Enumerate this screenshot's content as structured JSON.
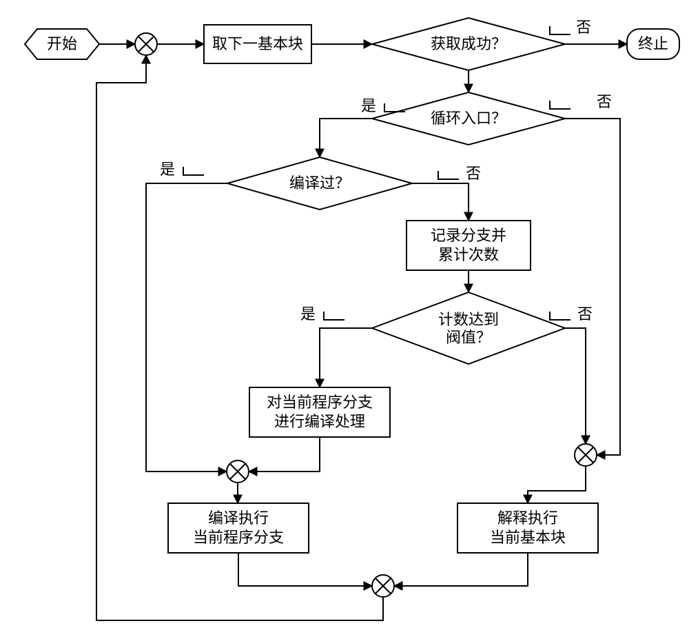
{
  "nodes": {
    "start": "开始",
    "end": "终止",
    "fetch": "取下一基本块",
    "q_success_l1": "获取成功？",
    "q_loopentry_l1": "循环入口？",
    "q_compiled_l1": "编译过？",
    "record_l1": "记录分支并",
    "record_l2": "累计次数",
    "q_threshold_l1": "计数达到",
    "q_threshold_l2": "阀值？",
    "compile_l1": "对当前程序分支",
    "compile_l2": "进行编译处理",
    "exec_compile_l1": "编译执行",
    "exec_compile_l2": "当前程序分支",
    "exec_interp_l1": "解释执行",
    "exec_interp_l2": "当前基本块"
  },
  "labels": {
    "yes": "是",
    "no": "否"
  }
}
